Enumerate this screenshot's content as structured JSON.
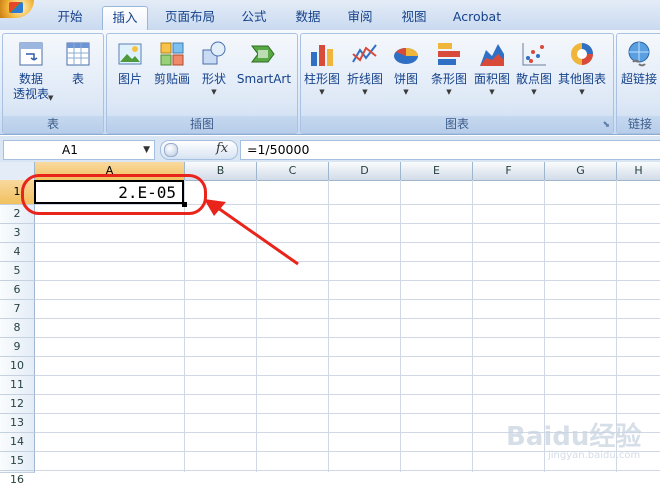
{
  "tabs": [
    "开始",
    "插入",
    "页面布局",
    "公式",
    "数据",
    "审阅",
    "视图",
    "Acrobat"
  ],
  "active_tab": "插入",
  "ribbon": {
    "groups": [
      {
        "label": "表",
        "buttons": [
          {
            "label": "数据\n透视表",
            "icon": "pivot-table-icon",
            "dropdown": true
          },
          {
            "label": "表",
            "icon": "table-icon",
            "dropdown": false
          }
        ]
      },
      {
        "label": "插图",
        "buttons": [
          {
            "label": "图片",
            "icon": "picture-icon",
            "dropdown": false
          },
          {
            "label": "剪贴画",
            "icon": "clip-art-icon",
            "dropdown": false
          },
          {
            "label": "形状",
            "icon": "shapes-icon",
            "dropdown": true
          },
          {
            "label": "SmartArt",
            "icon": "smartart-icon",
            "dropdown": false
          }
        ]
      },
      {
        "label": "图表",
        "buttons": [
          {
            "label": "柱形图",
            "icon": "column-chart-icon",
            "dropdown": true
          },
          {
            "label": "折线图",
            "icon": "line-chart-icon",
            "dropdown": true
          },
          {
            "label": "饼图",
            "icon": "pie-chart-icon",
            "dropdown": true
          },
          {
            "label": "条形图",
            "icon": "bar-chart-icon",
            "dropdown": true
          },
          {
            "label": "面积图",
            "icon": "area-chart-icon",
            "dropdown": true
          },
          {
            "label": "散点图",
            "icon": "scatter-chart-icon",
            "dropdown": true
          },
          {
            "label": "其他图表",
            "icon": "other-charts-icon",
            "dropdown": true
          }
        ]
      },
      {
        "label": "链接",
        "buttons": [
          {
            "label": "超链接",
            "icon": "hyperlink-icon",
            "dropdown": false
          }
        ]
      }
    ]
  },
  "formula_bar": {
    "name_box": "A1",
    "fx_label": "fx",
    "formula": "=1/50000"
  },
  "grid": {
    "columns": [
      "A",
      "B",
      "C",
      "D",
      "E",
      "F",
      "G",
      "H"
    ],
    "rows": [
      "1",
      "2",
      "3",
      "4",
      "5",
      "6",
      "7",
      "8",
      "9",
      "10",
      "11",
      "12",
      "13",
      "14",
      "15",
      "16"
    ],
    "selected_cell": "A1",
    "cells": {
      "A1": "2.E-05"
    }
  },
  "annotation": {
    "color": "#e8241b"
  },
  "watermark": {
    "text": "Baidu经验",
    "sub": "jingyan.baidu.com"
  },
  "colors": {
    "ribbon_text": "#15428b",
    "selection": "#f1c15f",
    "gridline": "#d0d7e5"
  }
}
